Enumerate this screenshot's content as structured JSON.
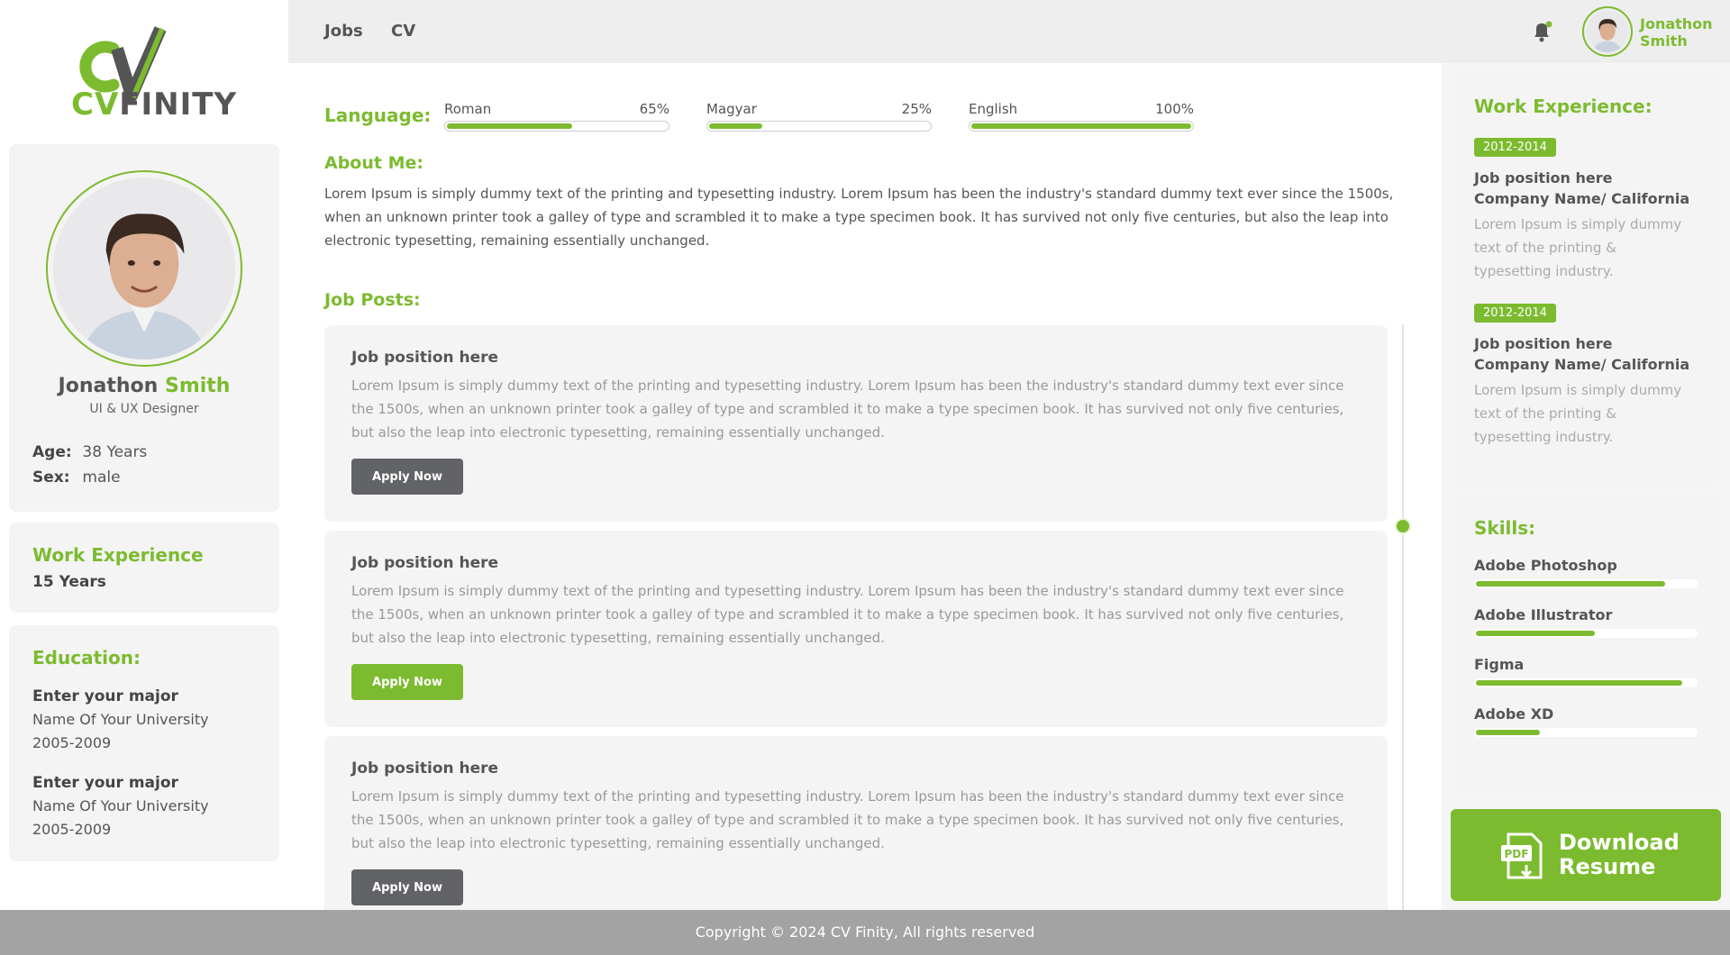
{
  "brand": {
    "logo_text_accent": "CV",
    "logo_text_rest": "FINITY",
    "accent_color": "#7cbb2f"
  },
  "nav": {
    "jobs": "Jobs",
    "cv": "CV"
  },
  "user": {
    "first": "Jonathon",
    "last": "Smith"
  },
  "profile": {
    "first_name": "Jonathon",
    "last_name": "Smith",
    "role": "UI & UX Designer",
    "age_label": "Age:",
    "age_value": "38 Years",
    "sex_label": "Sex:",
    "sex_value": "male"
  },
  "work_summary": {
    "title": "Work Experience",
    "years": "15 Years"
  },
  "education": {
    "title": "Education:",
    "items": [
      {
        "major": "Enter your major",
        "university": "Name Of Your University",
        "years": "2005-2009"
      },
      {
        "major": "Enter your major",
        "university": "Name Of Your University",
        "years": "2005-2009"
      }
    ]
  },
  "language": {
    "title": "Language:",
    "items": [
      {
        "name": "Roman",
        "percent_label": "65%",
        "level": 0.57
      },
      {
        "name": "Magyar",
        "percent_label": "25%",
        "level": 0.24
      },
      {
        "name": "English",
        "percent_label": "100%",
        "level": 1.0
      }
    ]
  },
  "about": {
    "title": "About Me:",
    "text": "Lorem Ipsum is simply dummy text of the printing and typesetting industry. Lorem Ipsum has been the industry's standard dummy text ever since the 1500s, when an unknown printer took a galley of type and scrambled it to make a type specimen book. It has survived not only five centuries, but also the leap into electronic typesetting, remaining essentially unchanged."
  },
  "job_posts": {
    "title": "Job Posts:",
    "items": [
      {
        "title": "Job position here",
        "text": "Lorem Ipsum is simply dummy text of the printing and typesetting industry. Lorem Ipsum has been the industry's standard dummy text ever since the 1500s, when an unknown printer took a galley of type and scrambled it to make a type specimen book. It has survived not only five centuries, but also the leap into electronic typesetting, remaining essentially unchanged.",
        "button": "Apply Now"
      },
      {
        "title": "Job position here",
        "text": "Lorem Ipsum is simply dummy text of the printing and typesetting industry. Lorem Ipsum has been the industry's standard dummy text ever since the 1500s, when an unknown printer took a galley of type and scrambled it to make a type specimen book. It has survived not only five centuries, but also the leap into electronic typesetting, remaining essentially unchanged.",
        "button": "Apply Now"
      },
      {
        "title": "Job position here",
        "text": "Lorem Ipsum is simply dummy text of the printing and typesetting industry. Lorem Ipsum has been the industry's standard dummy text ever since the 1500s, when an unknown printer took a galley of type and scrambled it to make a type specimen book. It has survived not only five centuries, but also the leap into electronic typesetting, remaining essentially unchanged.",
        "button": "Apply Now"
      }
    ]
  },
  "experience": {
    "title": "Work Experience:",
    "items": [
      {
        "years": "2012-2014",
        "position": "Job position here",
        "company": "Company Name/ California",
        "desc": "Lorem Ipsum is simply dummy text of the printing & typesetting industry."
      },
      {
        "years": "2012-2014",
        "position": "Job position here",
        "company": "Company Name/ California",
        "desc": "Lorem Ipsum is simply dummy text of the printing & typesetting industry."
      }
    ]
  },
  "skills": {
    "title": "Skills:",
    "items": [
      {
        "name": "Adobe Photoshop",
        "level": 0.86
      },
      {
        "name": "Adobe Illustrator",
        "level": 0.54
      },
      {
        "name": "Figma",
        "level": 0.94
      },
      {
        "name": "Adobe XD",
        "level": 0.29
      }
    ]
  },
  "download": {
    "line1": "Download",
    "line2": "Resume",
    "icon_label": "PDF"
  },
  "footer": {
    "text": "Copyright © 2024 CV Finity, All rights reserved"
  }
}
